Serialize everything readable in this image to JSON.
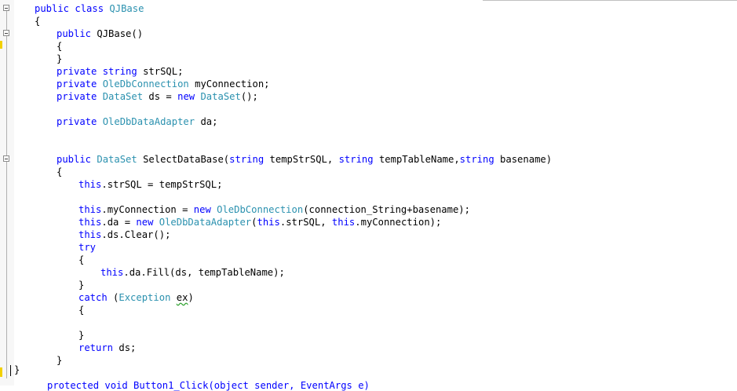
{
  "editor": {
    "fold_markers": [
      "collapse",
      "collapse",
      "collapse"
    ],
    "lines": [
      {
        "id": "l1",
        "tokens": [
          [
            "kw",
            "public class "
          ],
          [
            "tp",
            "QJBase"
          ]
        ]
      },
      {
        "id": "l2",
        "tokens": [
          [
            "pl",
            "{"
          ]
        ]
      },
      {
        "id": "l3",
        "tokens": [
          [
            "kw",
            "public "
          ],
          [
            "pl",
            "QJBase()"
          ]
        ]
      },
      {
        "id": "l4",
        "tokens": [
          [
            "pl",
            "{"
          ]
        ]
      },
      {
        "id": "l5",
        "tokens": [
          [
            "pl",
            "}"
          ]
        ]
      },
      {
        "id": "l6",
        "tokens": [
          [
            "kw",
            "private string "
          ],
          [
            "pl",
            "strSQL;"
          ]
        ]
      },
      {
        "id": "l7",
        "tokens": [
          [
            "kw",
            "private "
          ],
          [
            "tp",
            "OleDbConnection"
          ],
          [
            "pl",
            " myConnection;"
          ]
        ]
      },
      {
        "id": "l8",
        "tokens": [
          [
            "kw",
            "private "
          ],
          [
            "tp",
            "DataSet"
          ],
          [
            "pl",
            " ds = "
          ],
          [
            "kw",
            "new "
          ],
          [
            "tp",
            "DataSet"
          ],
          [
            "pl",
            "();"
          ]
        ]
      },
      {
        "id": "l9",
        "tokens": []
      },
      {
        "id": "l10",
        "tokens": [
          [
            "kw",
            "private "
          ],
          [
            "tp",
            "OleDbDataAdapter"
          ],
          [
            "pl",
            " da;"
          ]
        ]
      },
      {
        "id": "l11",
        "tokens": []
      },
      {
        "id": "l12",
        "tokens": []
      },
      {
        "id": "l13",
        "tokens": [
          [
            "kw",
            "public "
          ],
          [
            "tp",
            "DataSet"
          ],
          [
            "pl",
            " SelectDataBase("
          ],
          [
            "kw",
            "string"
          ],
          [
            "pl",
            " tempStrSQL, "
          ],
          [
            "kw",
            "string"
          ],
          [
            "pl",
            " tempTableName,"
          ],
          [
            "kw",
            "string"
          ],
          [
            "pl",
            " basename)"
          ]
        ]
      },
      {
        "id": "l14",
        "tokens": [
          [
            "pl",
            "{"
          ]
        ]
      },
      {
        "id": "l15",
        "tokens": [
          [
            "kw",
            "this"
          ],
          [
            "pl",
            ".strSQL = tempStrSQL;"
          ]
        ]
      },
      {
        "id": "l16",
        "tokens": []
      },
      {
        "id": "l17",
        "tokens": [
          [
            "kw",
            "this"
          ],
          [
            "pl",
            ".myConnection = "
          ],
          [
            "kw",
            "new "
          ],
          [
            "tp",
            "OleDbConnection"
          ],
          [
            "pl",
            "(connection_String+basename);"
          ]
        ]
      },
      {
        "id": "l18",
        "tokens": [
          [
            "kw",
            "this"
          ],
          [
            "pl",
            ".da = "
          ],
          [
            "kw",
            "new "
          ],
          [
            "tp",
            "OleDbDataAdapter"
          ],
          [
            "pl",
            "("
          ],
          [
            "kw",
            "this"
          ],
          [
            "pl",
            ".strSQL, "
          ],
          [
            "kw",
            "this"
          ],
          [
            "pl",
            ".myConnection);"
          ]
        ]
      },
      {
        "id": "l19",
        "tokens": [
          [
            "kw",
            "this"
          ],
          [
            "pl",
            ".ds.Clear();"
          ]
        ]
      },
      {
        "id": "l20",
        "tokens": [
          [
            "kw",
            "try"
          ]
        ]
      },
      {
        "id": "l21",
        "tokens": [
          [
            "pl",
            "{"
          ]
        ]
      },
      {
        "id": "l22",
        "tokens": [
          [
            "kw",
            "this"
          ],
          [
            "pl",
            ".da.Fill(ds, tempTableName);"
          ]
        ]
      },
      {
        "id": "l23",
        "tokens": [
          [
            "pl",
            "}"
          ]
        ]
      },
      {
        "id": "l24",
        "tokens": [
          [
            "kw",
            "catch "
          ],
          [
            "pl",
            "("
          ],
          [
            "tp",
            "Exception"
          ],
          [
            "pl",
            " "
          ],
          [
            "sq",
            "ex"
          ],
          [
            "pl",
            ")"
          ]
        ]
      },
      {
        "id": "l25",
        "tokens": [
          [
            "pl",
            "{"
          ]
        ]
      },
      {
        "id": "l26",
        "tokens": []
      },
      {
        "id": "l27",
        "tokens": [
          [
            "pl",
            "}"
          ]
        ]
      },
      {
        "id": "l28",
        "tokens": [
          [
            "kw",
            "return "
          ],
          [
            "pl",
            "ds;"
          ]
        ]
      },
      {
        "id": "l29",
        "tokens": [
          [
            "pl",
            "}"
          ]
        ]
      }
    ],
    "bottom_brace": "}",
    "cut_line": "protected void Button1_Click(object sender, EventArgs e)"
  }
}
